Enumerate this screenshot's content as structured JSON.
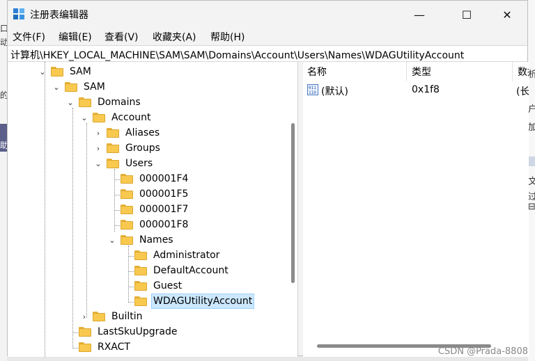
{
  "window": {
    "title": "注册表编辑器",
    "controls": {
      "minimize": "—",
      "maximize": "☐",
      "close": "✕"
    }
  },
  "menu": [
    "文件(F)",
    "编辑(E)",
    "查看(V)",
    "收藏夹(A)",
    "帮助(H)"
  ],
  "address": "计算机\\HKEY_LOCAL_MACHINE\\SAM\\SAM\\Domains\\Account\\Users\\Names\\WDAGUtilityAccount",
  "tree": [
    {
      "label": "SAM",
      "expanded": true
    },
    {
      "label": "SAM",
      "expanded": true
    },
    {
      "label": "Domains",
      "expanded": true
    },
    {
      "label": "Account",
      "expanded": true
    },
    {
      "label": "Aliases",
      "expanded": false
    },
    {
      "label": "Groups",
      "expanded": false
    },
    {
      "label": "Users",
      "expanded": true
    },
    {
      "label": "000001F4"
    },
    {
      "label": "000001F5"
    },
    {
      "label": "000001F7"
    },
    {
      "label": "000001F8"
    },
    {
      "label": "Names",
      "expanded": true
    },
    {
      "label": "Administrator"
    },
    {
      "label": "DefaultAccount"
    },
    {
      "label": "Guest"
    },
    {
      "label": "WDAGUtilityAccount",
      "selected": true
    },
    {
      "label": "Builtin",
      "expanded": false
    },
    {
      "label": "LastSkuUpgrade"
    },
    {
      "label": "RXACT"
    }
  ],
  "list": {
    "columns": [
      "名称",
      "类型",
      "数据"
    ],
    "rows": [
      {
        "name": "(默认)",
        "type": "0x1f8",
        "data": "(长"
      }
    ]
  },
  "watermark": "CSDN @Prada-8808",
  "background": {
    "left_fragments": [
      "口",
      "动",
      "的",
      "助"
    ],
    "right_fragments": [
      "析",
      "户",
      "加",
      "文",
      "过",
      "⊟"
    ]
  }
}
